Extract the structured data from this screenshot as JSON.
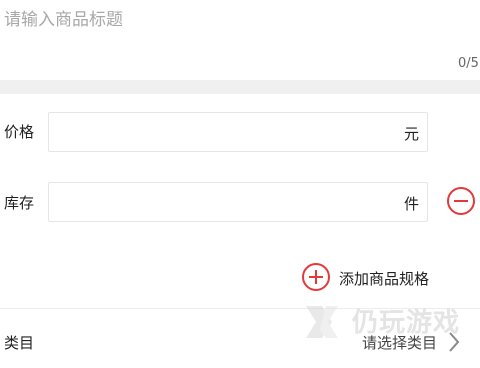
{
  "title": {
    "placeholder": "请输入商品标题",
    "value": "",
    "counter": "0/5"
  },
  "price": {
    "label": "价格",
    "value": "",
    "unit": "元"
  },
  "stock": {
    "label": "库存",
    "value": "",
    "unit": "件"
  },
  "add_spec": {
    "label": "添加商品规格"
  },
  "category": {
    "label": "类目",
    "value": "请选择类目"
  },
  "watermark": {
    "text": "仍玩游戏"
  },
  "colors": {
    "accent": "#e23a3a",
    "separator": "#f0f0f0",
    "border": "#e6e6e6",
    "placeholder": "#a8a8a8"
  },
  "icons": {
    "remove": "minus-circle-icon",
    "add": "plus-circle-icon",
    "chevron": "chevron-right-icon"
  }
}
